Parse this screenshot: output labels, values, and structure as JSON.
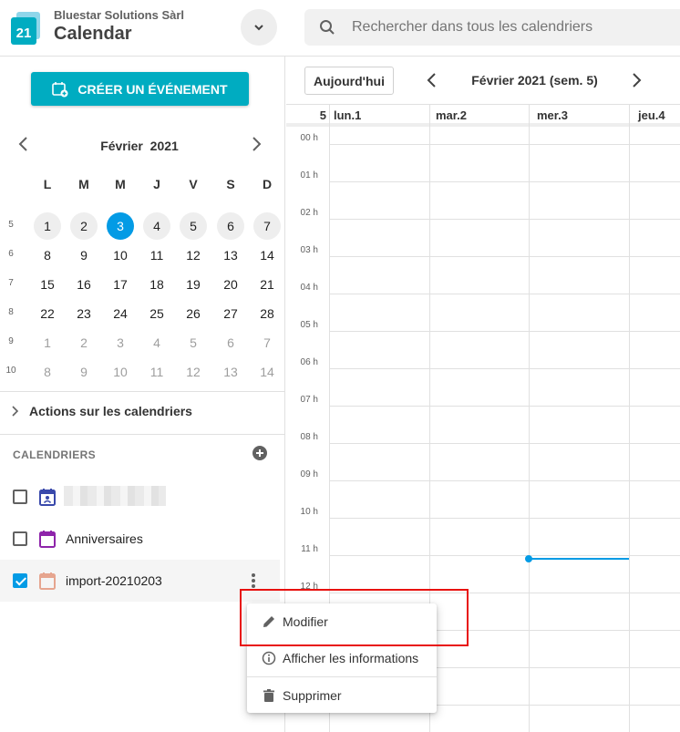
{
  "header": {
    "org_name": "Bluestar Solutions Sàrl",
    "app_name": "Calendar",
    "logo_number": "21",
    "search_placeholder": "Rechercher dans tous les calendriers"
  },
  "sidebar": {
    "create_button": "CRÉER UN ÉVÉNEMENT",
    "mini_calendar": {
      "month_label": "Février  2021",
      "weekdays": [
        "L",
        "M",
        "M",
        "J",
        "V",
        "S",
        "D"
      ],
      "weeks": [
        {
          "num": "5",
          "days": [
            "1",
            "2",
            "3",
            "4",
            "5",
            "6",
            "7"
          ]
        },
        {
          "num": "6",
          "days": [
            "8",
            "9",
            "10",
            "11",
            "12",
            "13",
            "14"
          ]
        },
        {
          "num": "7",
          "days": [
            "15",
            "16",
            "17",
            "18",
            "19",
            "20",
            "21"
          ]
        },
        {
          "num": "8",
          "days": [
            "22",
            "23",
            "24",
            "25",
            "26",
            "27",
            "28"
          ]
        },
        {
          "num": "9",
          "days": [
            "1",
            "2",
            "3",
            "4",
            "5",
            "6",
            "7"
          ]
        },
        {
          "num": "10",
          "days": [
            "8",
            "9",
            "10",
            "11",
            "12",
            "13",
            "14"
          ]
        }
      ],
      "selected_week": "5",
      "today": "3"
    },
    "actions_label": "Actions sur les calendriers",
    "calendars_heading": "CALENDRIERS",
    "calendars": [
      {
        "name": "",
        "checked": false,
        "color": "#3949ab",
        "icon": "contacts-calendar-icon"
      },
      {
        "name": "Anniversaires",
        "checked": false,
        "color": "#8e24aa",
        "icon": "calendar-icon"
      },
      {
        "name": "import-20210203",
        "checked": true,
        "color": "#e6a58f",
        "icon": "calendar-icon"
      }
    ]
  },
  "toolbar": {
    "today_button": "Aujourd'hui",
    "period_label": "Février 2021 (sem. 5)"
  },
  "week_view": {
    "week_number": "5",
    "day_headers": [
      "lun.1",
      "mar.2",
      "mer.3",
      "jeu.4"
    ],
    "hours": [
      "00 h",
      "01 h",
      "02 h",
      "03 h",
      "04 h",
      "05 h",
      "06 h",
      "07 h",
      "08 h",
      "09 h",
      "10 h",
      "11 h",
      "12 h"
    ]
  },
  "context_menu": {
    "items": [
      {
        "label": "Modifier",
        "icon": "pencil-icon"
      },
      {
        "label": "Afficher les informations",
        "icon": "info-icon"
      },
      {
        "label": "Supprimer",
        "icon": "trash-icon"
      }
    ]
  },
  "colors": {
    "accent": "#00acc1",
    "today": "#039be5",
    "highlight": "#e8110f"
  }
}
